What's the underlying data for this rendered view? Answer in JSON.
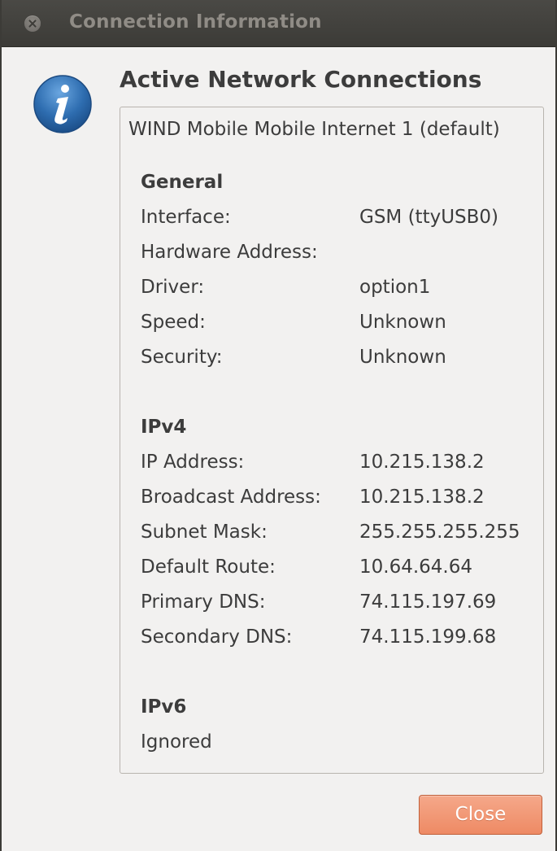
{
  "window": {
    "title": "Connection Information"
  },
  "dialog": {
    "icon": "info-icon",
    "heading": "Active Network Connections",
    "connection_tab": "WIND Mobile Mobile Internet 1 (default)"
  },
  "general": {
    "title": "General",
    "rows": [
      {
        "label": "Interface:",
        "value": "GSM (ttyUSB0)"
      },
      {
        "label": "Hardware Address:",
        "value": ""
      },
      {
        "label": "Driver:",
        "value": "option1"
      },
      {
        "label": "Speed:",
        "value": "Unknown"
      },
      {
        "label": "Security:",
        "value": "Unknown"
      }
    ]
  },
  "ipv4": {
    "title": "IPv4",
    "rows": [
      {
        "label": "IP Address:",
        "value": "10.215.138.2"
      },
      {
        "label": "Broadcast Address:",
        "value": "10.215.138.2"
      },
      {
        "label": "Subnet Mask:",
        "value": "255.255.255.255"
      },
      {
        "label": "Default Route:",
        "value": "10.64.64.64"
      },
      {
        "label": "Primary DNS:",
        "value": "74.115.197.69"
      },
      {
        "label": "Secondary DNS:",
        "value": "74.115.199.68"
      }
    ]
  },
  "ipv6": {
    "title": "IPv6",
    "status": "Ignored"
  },
  "buttons": {
    "close_label": "Close"
  },
  "colors": {
    "titlebar": "#3c3b37",
    "dialog_background": "#f2f1f0",
    "close_button": "#ee8a64",
    "info_icon": "#2e6db0"
  }
}
